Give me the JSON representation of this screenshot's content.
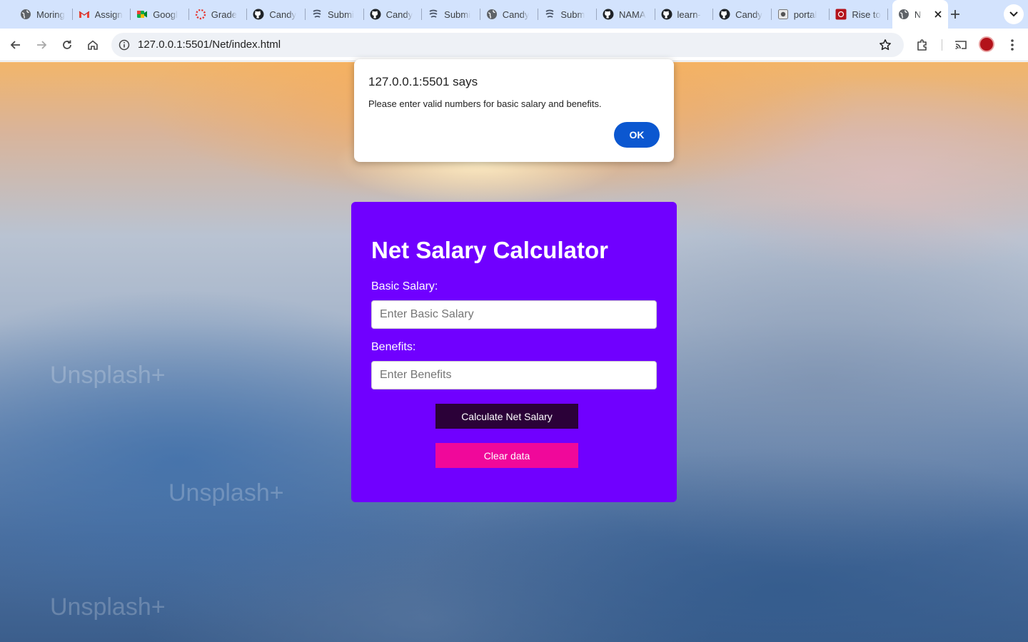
{
  "browser": {
    "tabs": [
      {
        "title": "Moring",
        "icon": "globe-icon"
      },
      {
        "title": "Assign",
        "icon": "gmail-icon"
      },
      {
        "title": "Googl",
        "icon": "google-meet-icon"
      },
      {
        "title": "Grade",
        "icon": "loading-spinner-icon"
      },
      {
        "title": "Candy",
        "icon": "github-icon"
      },
      {
        "title": "Submi",
        "icon": "canvas-icon"
      },
      {
        "title": "Candy",
        "icon": "github-icon"
      },
      {
        "title": "Submi",
        "icon": "canvas-icon"
      },
      {
        "title": "Candy",
        "icon": "globe-icon"
      },
      {
        "title": "Subm",
        "icon": "canvas-icon"
      },
      {
        "title": "NAMA",
        "icon": "github-icon"
      },
      {
        "title": "learn-",
        "icon": "github-icon"
      },
      {
        "title": "Candy",
        "icon": "github-icon"
      },
      {
        "title": "portal",
        "icon": "portal-icon"
      },
      {
        "title": "Rise to",
        "icon": "red-square-icon"
      }
    ],
    "active_tab": {
      "title": "N",
      "icon": "globe-icon"
    },
    "url": "127.0.0.1:5501/Net/index.html"
  },
  "dialog": {
    "title": "127.0.0.1:5501 says",
    "message": "Please enter valid numbers for basic salary and benefits.",
    "ok_label": "OK"
  },
  "calculator": {
    "title": "Net Salary Calculator",
    "basic_label": "Basic Salary:",
    "basic_placeholder": "Enter Basic Salary",
    "benefits_label": "Benefits:",
    "benefits_placeholder": "Enter Benefits",
    "calculate_label": "Calculate Net Salary",
    "clear_label": "Clear data"
  },
  "background": {
    "watermark": "Unsplash+"
  },
  "colors": {
    "card": "#7000ff",
    "calculate_button": "#2b0138",
    "clear_button": "#f0089a",
    "dialog_ok": "#0b57d0",
    "tabstrip": "#d3e3fd"
  }
}
